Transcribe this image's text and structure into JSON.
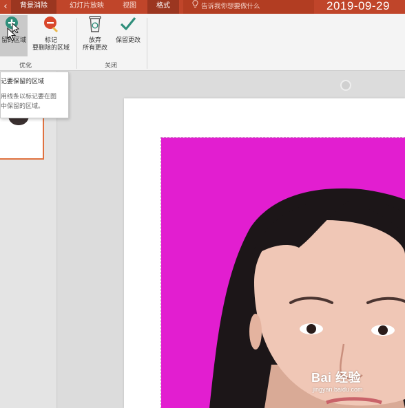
{
  "tabs": [
    {
      "label": "背景消除",
      "active": true
    },
    {
      "label": "幻灯片放映",
      "active": false
    },
    {
      "label": "视图",
      "active": false
    },
    {
      "label": "格式",
      "active": true
    }
  ],
  "tell_me": {
    "text": "告诉我你想要做什么",
    "icon": "lightbulb-icon"
  },
  "date_overlay": "2019-09-29",
  "ribbon": {
    "keep_button": {
      "label": "留的区域",
      "icon": "plus-pencil-icon"
    },
    "remove_button": {
      "line1": "标记",
      "line2": "要删除的区域",
      "icon": "minus-pencil-icon"
    },
    "discard_button": {
      "line1": "放弃",
      "line2": "所有更改",
      "icon": "trash-icon"
    },
    "keep_changes_button": {
      "label": "保留更改",
      "icon": "checkmark-icon"
    },
    "group_optimize": "优化",
    "group_close": "关闭"
  },
  "tooltip": {
    "title": "记要保留的区域",
    "line1": "用线条以标记要在图",
    "line2": "中保留的区域。"
  },
  "watermark": {
    "main": "Bai 经验",
    "sub": "jingyan.baidu.com"
  },
  "colors": {
    "accent": "#c0452a",
    "photo_background": "#e21ed0",
    "thumbnail_border": "#e0713f",
    "keep_icon": "#2f8f7b",
    "remove_icon": "#d9472b"
  }
}
